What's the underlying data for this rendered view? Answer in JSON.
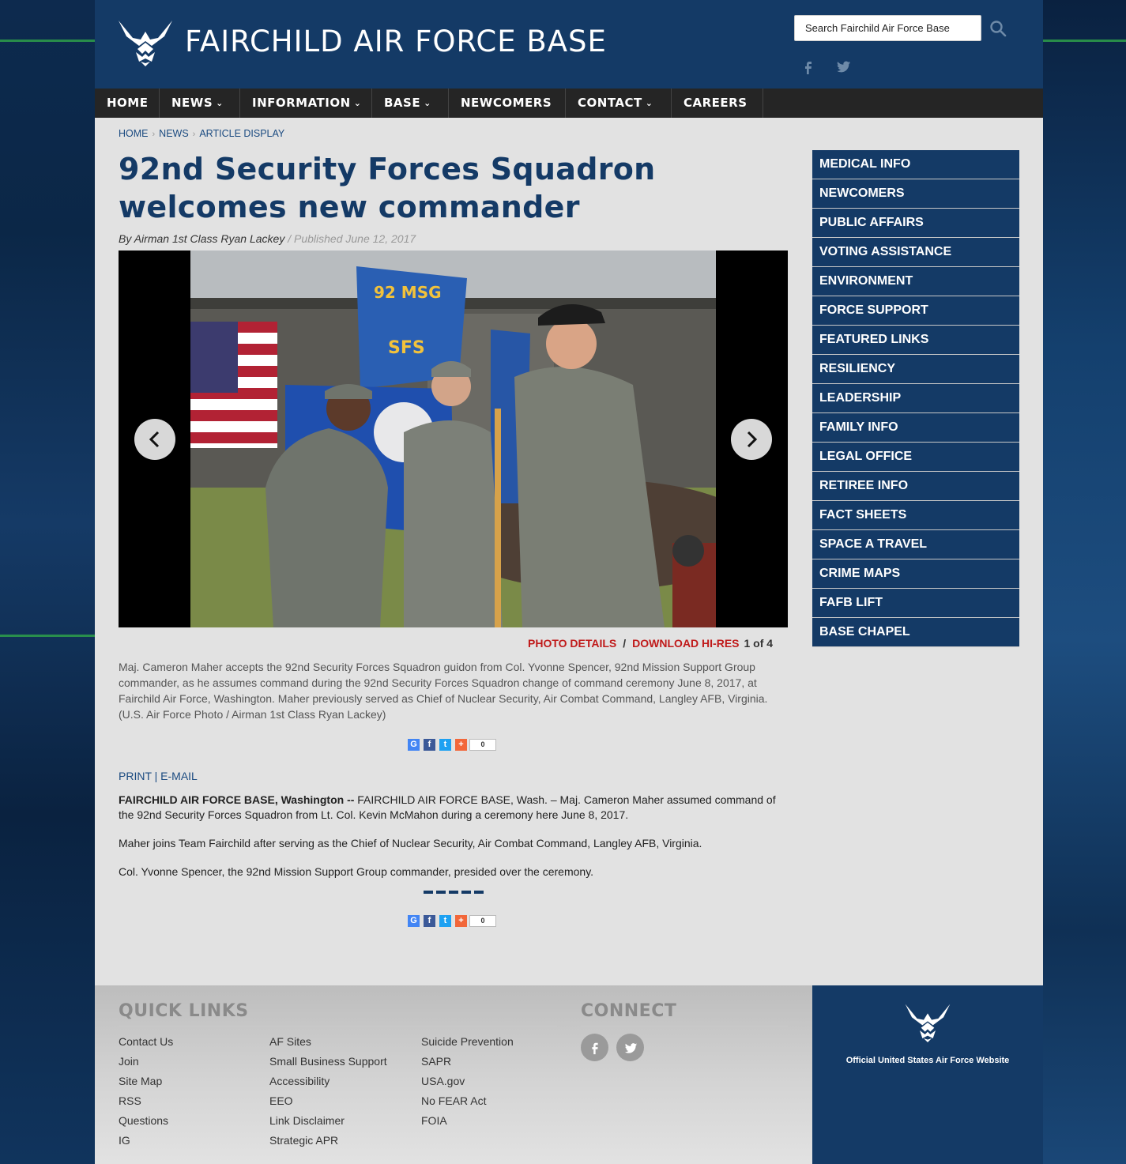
{
  "header": {
    "site_title": "FAIRCHILD AIR FORCE BASE",
    "search_placeholder": "Search Fairchild Air Force Base"
  },
  "nav": [
    {
      "label": "HOME"
    },
    {
      "label": "NEWS"
    },
    {
      "label": "INFORMATION"
    },
    {
      "label": "BASE"
    },
    {
      "label": "NEWCOMERS"
    },
    {
      "label": "CONTACT"
    },
    {
      "label": "CAREERS"
    }
  ],
  "breadcrumb": [
    "HOME",
    "NEWS",
    "ARTICLE DISPLAY"
  ],
  "article": {
    "title": "92nd Security Forces Squadron welcomes new commander",
    "byline": "By Airman 1st Class Ryan Lackey",
    "published": "/ Published June 12, 2017",
    "photo_details": "PHOTO DETAILS",
    "photo_sep": "/",
    "download": "DOWNLOAD HI-RES",
    "photo_count": "1 of 4",
    "photo_labels": {
      "flag_top": "92 MSG",
      "flag_bottom": "SFS"
    },
    "caption": "Maj. Cameron Maher accepts the 92nd Security Forces Squadron guidon from Col. Yvonne Spencer, 92nd Mission Support Group commander, as he assumes command during the 92nd Security Forces Squadron change of command ceremony June 8, 2017, at Fairchild Air Force, Washington. Maher previously served as Chief of Nuclear Security, Air Combat Command, Langley AFB, Virginia. (U.S. Air Force Photo / Airman 1st Class Ryan Lackey)",
    "share_count": "0",
    "print": "PRINT",
    "pipe": "|",
    "email": "E-MAIL",
    "dateline": "FAIRCHILD AIR FORCE BASE, Washington --",
    "para1": " FAIRCHILD AIR FORCE BASE, Wash. – Maj. Cameron Maher assumed command of the 92nd Security Forces Squadron from Lt. Col. Kevin McMahon during a ceremony here June 8, 2017.",
    "para2": "Maher joins Team Fairchild after serving as the Chief of Nuclear Security, Air Combat Command, Langley AFB, Virginia.",
    "para3": "Col. Yvonne Spencer, the 92nd Mission Support Group commander, presided over the ceremony."
  },
  "sidebar": [
    "MEDICAL INFO",
    "NEWCOMERS",
    "PUBLIC AFFAIRS",
    "VOTING ASSISTANCE",
    "ENVIRONMENT",
    "FORCE SUPPORT",
    "FEATURED LINKS",
    "RESILIENCY",
    "LEADERSHIP",
    "FAMILY INFO",
    "LEGAL OFFICE",
    "RETIREE INFO",
    "FACT SHEETS",
    "SPACE A TRAVEL",
    "CRIME MAPS",
    "FAFB LIFT",
    "BASE CHAPEL"
  ],
  "footer": {
    "quick_links_heading": "QUICK LINKS",
    "connect_heading": "CONNECT",
    "col1": [
      "Contact Us",
      "Join",
      "Site Map",
      "RSS",
      "Questions",
      "IG"
    ],
    "col2": [
      "AF Sites",
      "Small Business Support",
      "Accessibility",
      "EEO",
      "Link Disclaimer",
      "Strategic APR"
    ],
    "col3": [
      "Suicide Prevention",
      "SAPR",
      "USA.gov",
      "No FEAR Act",
      "FOIA"
    ],
    "official": "Official United States Air Force Website"
  },
  "colors": {
    "brand_blue": "#143a66",
    "accent_red": "#c01a1a",
    "nav_dark": "#252525"
  },
  "icons": [
    "af-logo-icon",
    "search-icon",
    "facebook-icon",
    "twitter-icon",
    "chevron-left-icon",
    "chevron-right-icon",
    "chevron-down-icon"
  ]
}
